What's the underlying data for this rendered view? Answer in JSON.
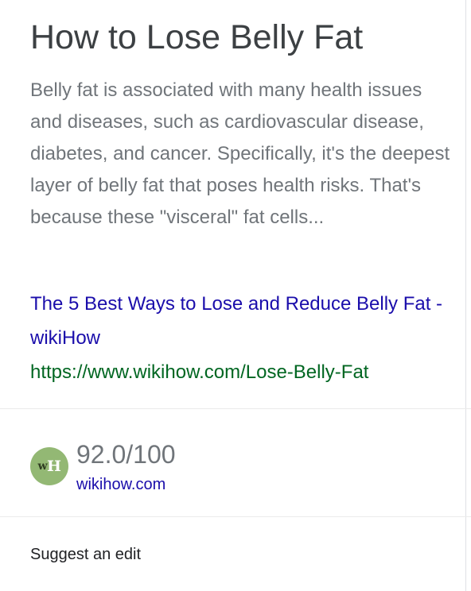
{
  "title": "How to Lose Belly Fat",
  "snippet": "Belly fat is associated with many health issues and diseases, such as cardiovascular disease, diabetes, and cancer. Specifically, it's the deepest layer of belly fat that poses health risks. That's because these \"visceral\" fat cells...",
  "result": {
    "link_text": "The 5 Best Ways to Lose and Reduce Belly Fat - wikiHow",
    "url": "https://www.wikihow.com/Lose-Belly-Fat"
  },
  "rating": {
    "logo_text": "wH",
    "logo_icon": "wikihow-logo-icon",
    "score": "92.0/100",
    "source": "wikihow.com"
  },
  "footer": {
    "suggest_label": "Suggest an edit"
  },
  "colors": {
    "title": "#3c4043",
    "snippet": "#70757a",
    "link": "#1a0dab",
    "url": "#006621",
    "logo_bg": "#93b874",
    "divider": "#ebebeb"
  }
}
